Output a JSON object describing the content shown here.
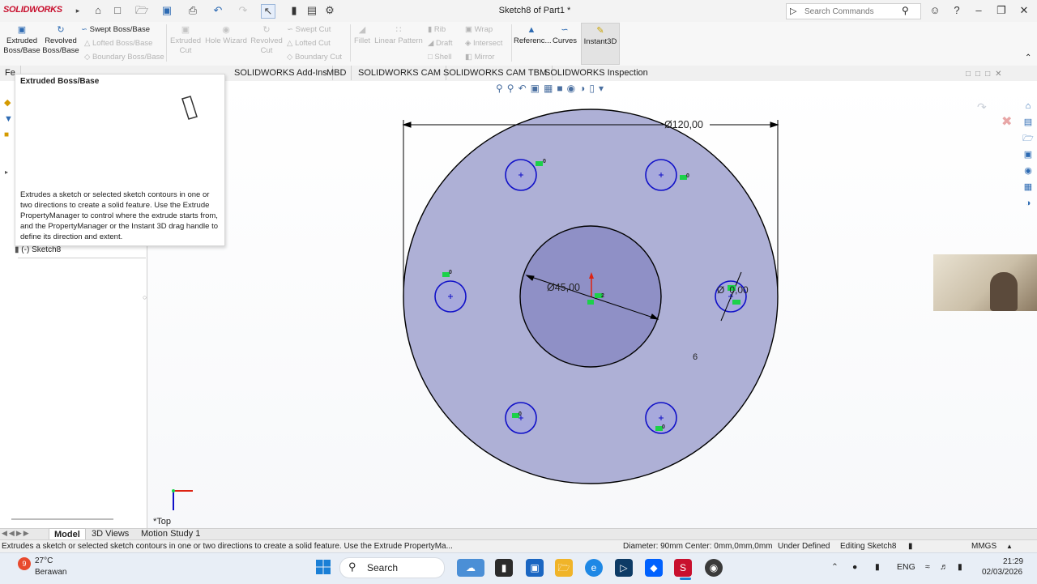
{
  "app": {
    "logo_text": "SOLIDWORKS",
    "document_title": "Sketch8 of Part1 *"
  },
  "search": {
    "placeholder": "Search Commands"
  },
  "ribbon": {
    "extruded_boss_base": "Extruded Boss/Base",
    "revolved_boss_base": "Revolved Boss/Base",
    "swept_boss_base": "Swept Boss/Base",
    "lofted_boss_base": "Lofted Boss/Base",
    "boundary_boss_base": "Boundary Boss/Base",
    "extruded_cut": "Extruded Cut",
    "hole_wizard": "Hole Wizard",
    "revolved_cut": "Revolved Cut",
    "swept_cut": "Swept Cut",
    "lofted_cut": "Lofted Cut",
    "boundary_cut": "Boundary Cut",
    "fillet": "Fillet",
    "linear_pattern": "Linear Pattern",
    "rib": "Rib",
    "draft": "Draft",
    "shell": "Shell",
    "wrap": "Wrap",
    "intersect": "Intersect",
    "mirror": "Mirror",
    "reference": "Referenc...",
    "curves": "Curves",
    "instant3d": "Instant3D"
  },
  "command_tabs": {
    "features_partial": "Fe",
    "addins": "SOLIDWORKS Add-Ins",
    "mbd": "MBD",
    "cam": "SOLIDWORKS CAM",
    "cam_tbm": "SOLIDWORKS CAM TBM",
    "inspection": "SOLIDWORKS Inspection"
  },
  "tooltip": {
    "title": "Extruded Boss/Base",
    "body": "Extrudes a sketch or selected sketch contours in one or two directions to create a solid feature. Use the Extrude PropertyManager to control where the extrude starts from, and the PropertyManager or the Instant 3D drag handle to define its direction and extent."
  },
  "tree": {
    "sketch_item": "(-) Sketch8"
  },
  "sketch": {
    "dim_outer": "Ø120,00",
    "dim_center": "Ø45,00",
    "dim_small": "Ø",
    "dim_small_value": "0,00",
    "note_6": "6",
    "relation_0": "0",
    "relation_2": "2",
    "view_label": "*Top",
    "fill_color": "#aeb0d6",
    "inner_fill_color": "#8f90c6",
    "hole_fill_color": "#a7a9dc",
    "hole_edge_color": "#1010c8"
  },
  "bottom_tabs": {
    "model": "Model",
    "views3d": "3D Views",
    "motion": "Motion Study 1"
  },
  "status": {
    "message": "Extrudes a sketch or selected sketch contours in one or two directions to create a solid feature. Use the Extrude PropertyMa...",
    "geometry": "Diameter: 90mm  Center: 0mm,0mm,0mm",
    "definition": "Under Defined",
    "mode": "Editing Sketch8",
    "units": "MMGS"
  },
  "taskbar": {
    "weather_temp": "27°C",
    "weather_desc": "Berawan",
    "weather_badge": "9",
    "search_label": "Search",
    "language": "ENG",
    "time": "21:29",
    "date": "02/03/2026"
  }
}
